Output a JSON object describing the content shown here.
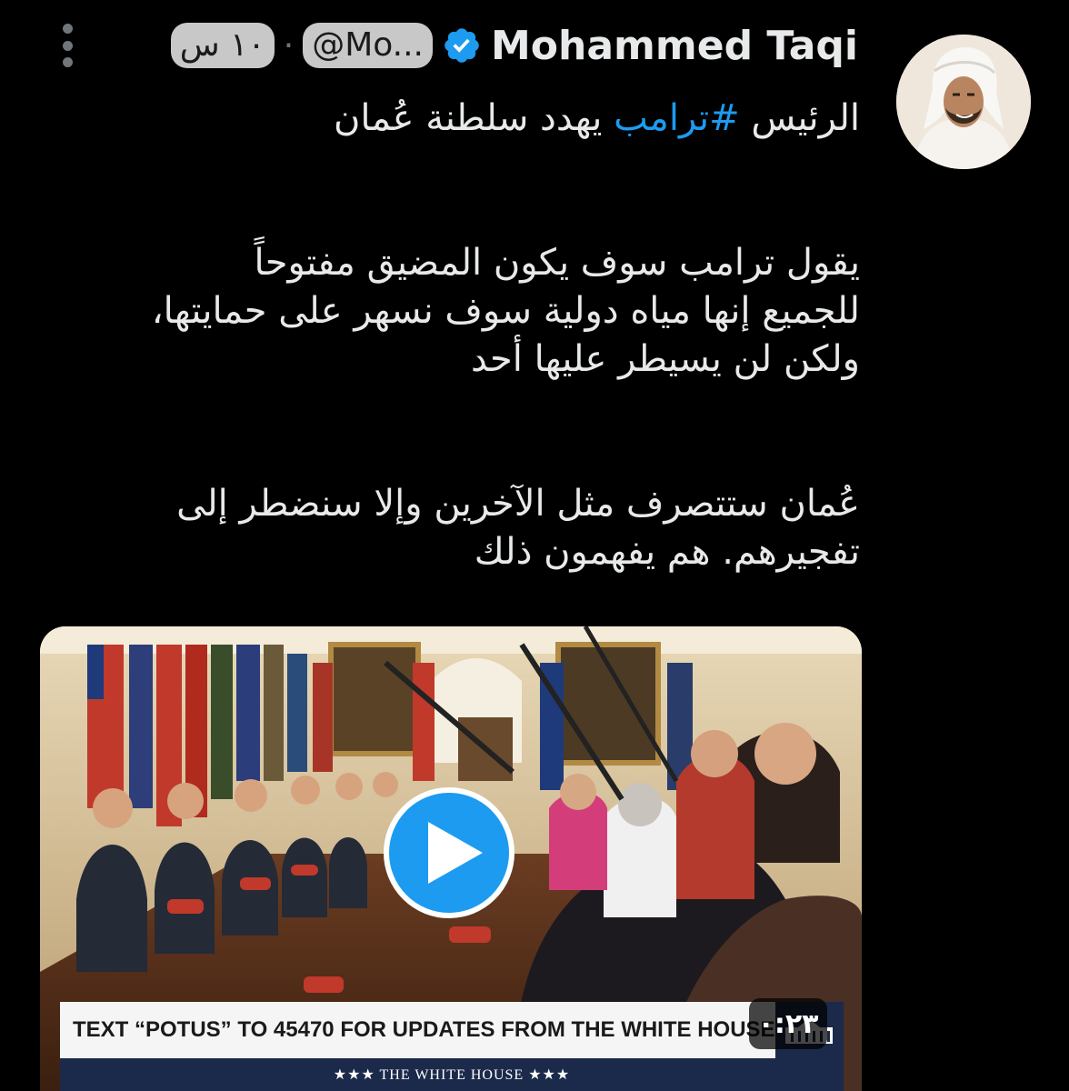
{
  "tweet": {
    "author_name": "Mohammed Taqi",
    "handle": "@Mo...",
    "separator": "·",
    "time": "١٠ س",
    "line1_before": "الرئيس ",
    "hashtag": "#ترامب",
    "line1_after": " يهدد سلطنة عُمان",
    "paragraph2": [
      "يقول ترامب سوف يكون المضيق مفتوحاً",
      "للجميع إنها مياه دولية سوف نسهر على حمايتها،",
      "ولكن لن يسيطر عليها أحد"
    ],
    "paragraph3": [
      "عُمان ستتصرف مثل الآخرين وإلا سنضطر إلى",
      "تفجيرهم. هم يفهمون ذلك"
    ]
  },
  "video": {
    "banner_text": "TEXT “POTUS” TO 45470 FOR UPDATES FROM THE WHITE HOUSE",
    "banner_sub": "★★★  THE WHITE HOUSE  ★★★",
    "duration": "٠:٢٣"
  },
  "colors": {
    "link": "#1d9bf0",
    "verified": "#1d9bf0",
    "text": "#e7e9ea",
    "background": "#000000"
  },
  "icons": [
    "more-options-icon",
    "verified-badge-icon",
    "play-icon"
  ]
}
